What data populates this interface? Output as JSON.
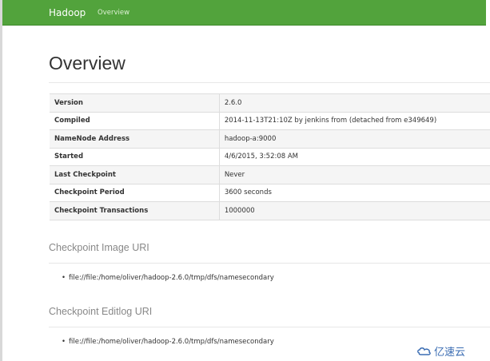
{
  "navbar": {
    "brand": "Hadoop",
    "links": [
      "Overview"
    ]
  },
  "page": {
    "title": "Overview"
  },
  "overview_table": [
    {
      "key": "Version",
      "value": "2.6.0"
    },
    {
      "key": "Compiled",
      "value": "2014-11-13T21:10Z by jenkins from (detached from e349649)"
    },
    {
      "key": "NameNode Address",
      "value": "hadoop-a:9000"
    },
    {
      "key": "Started",
      "value": "4/6/2015, 3:52:08 AM"
    },
    {
      "key": "Last Checkpoint",
      "value": "Never"
    },
    {
      "key": "Checkpoint Period",
      "value": "3600 seconds"
    },
    {
      "key": "Checkpoint Transactions",
      "value": "1000000"
    }
  ],
  "sections": [
    {
      "heading": "Checkpoint Image URI",
      "items": [
        "file://file:/home/oliver/hadoop-2.6.0/tmp/dfs/namesecondary"
      ]
    },
    {
      "heading": "Checkpoint Editlog URI",
      "items": [
        "file://file:/home/oliver/hadoop-2.6.0/tmp/dfs/namesecondary"
      ]
    }
  ],
  "watermark": {
    "text": "亿速云",
    "icon": "cloud-logo-icon"
  },
  "colors": {
    "navbar": "#52a33c",
    "heading_muted": "#888888",
    "watermark": "#3b6db3"
  }
}
